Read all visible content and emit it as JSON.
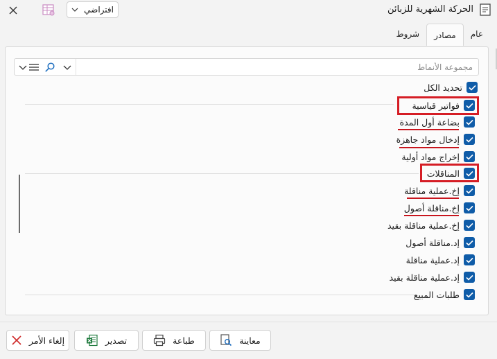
{
  "window": {
    "title": "الحركة الشهرية للزبائن",
    "profile_value": "افتراضي"
  },
  "tabs": [
    {
      "label": "عام",
      "active": false
    },
    {
      "label": "مصادر",
      "active": true
    },
    {
      "label": "شروط",
      "active": false
    }
  ],
  "search": {
    "placeholder": "مجموعة الأنماط"
  },
  "items": [
    {
      "label": "تحديد الكل",
      "checked": true
    },
    {
      "label": "فواتير قياسية",
      "checked": true
    },
    {
      "label": "بضاعة أول المدة",
      "checked": true
    },
    {
      "label": "إدخال مواد جاهزة",
      "checked": true
    },
    {
      "label": "إخراج مواد أولية",
      "checked": true
    },
    {
      "label": "المناقلات",
      "checked": true
    },
    {
      "label": "إخ.عملية مناقلة",
      "checked": true
    },
    {
      "label": "إخ.مناقلة أصول",
      "checked": true
    },
    {
      "label": "إخ.عملية مناقلة بقيد",
      "checked": true
    },
    {
      "label": "إد.مناقلة أصول",
      "checked": true
    },
    {
      "label": "إد.عملية مناقلة",
      "checked": true
    },
    {
      "label": "إد.عملية مناقلة بقيد",
      "checked": true
    },
    {
      "label": "طلبات المبيع",
      "checked": true
    }
  ],
  "footer": {
    "preview_label": "معاينة",
    "print_label": "طباعة",
    "export_label": "تصدير",
    "cancel_label": "إلغاء الأمر"
  },
  "colors": {
    "checkbox": "#0f5ca8",
    "highlight": "#d51d25",
    "export_icon": "#1e7a3c",
    "cancel_icon": "#d02d2d"
  }
}
